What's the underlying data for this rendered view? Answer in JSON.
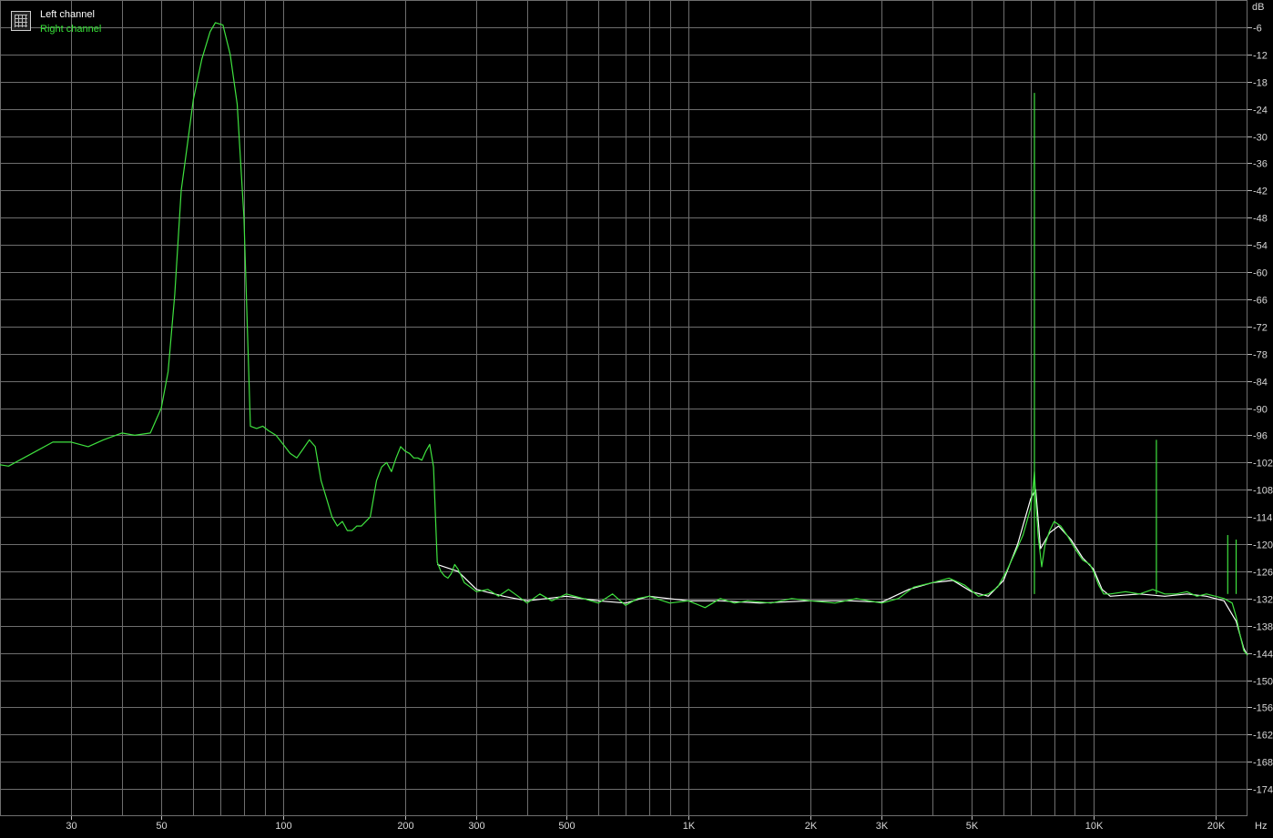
{
  "legend": {
    "icon": "spectrum-grid-icon",
    "left_label": "Left channel",
    "right_label": "Right channel",
    "left_color": "#ffffff",
    "right_color": "#3fe23f"
  },
  "chart_data": {
    "type": "line",
    "title": "",
    "xlabel": "",
    "ylabel": "",
    "x_unit_label": "Hz",
    "y_unit_label": "dB",
    "x_scale": "log",
    "xlim": [
      20,
      24000
    ],
    "ylim": [
      -180,
      0
    ],
    "grid": true,
    "background": "#000000",
    "grid_color": "#6e6e6e",
    "x_ticks": [
      {
        "value": 30,
        "label": "30"
      },
      {
        "value": 50,
        "label": "50"
      },
      {
        "value": 100,
        "label": "100"
      },
      {
        "value": 200,
        "label": "200"
      },
      {
        "value": 300,
        "label": "300"
      },
      {
        "value": 500,
        "label": "500"
      },
      {
        "value": 1000,
        "label": "1K"
      },
      {
        "value": 2000,
        "label": "2K"
      },
      {
        "value": 3000,
        "label": "3K"
      },
      {
        "value": 5000,
        "label": "5K"
      },
      {
        "value": 10000,
        "label": "10K"
      },
      {
        "value": 20000,
        "label": "20K"
      }
    ],
    "x_grid": [
      20,
      30,
      40,
      50,
      60,
      70,
      80,
      90,
      100,
      200,
      300,
      400,
      500,
      600,
      700,
      800,
      900,
      1000,
      2000,
      3000,
      4000,
      5000,
      6000,
      7000,
      8000,
      9000,
      10000,
      20000
    ],
    "y_ticks": [
      "-6",
      "-12",
      "-18",
      "-24",
      "-30",
      "-36",
      "-42",
      "-48",
      "-54",
      "-60",
      "-66",
      "-72",
      "-78",
      "-84",
      "-90",
      "-96",
      "-102",
      "-108",
      "-114",
      "-120",
      "-126",
      "-132",
      "-138",
      "-144",
      "-150",
      "-156",
      "-162",
      "-168",
      "-174"
    ],
    "series": [
      {
        "name": "Right channel",
        "color": "#3fe23f",
        "points": [
          [
            20,
            -102.5
          ],
          [
            21,
            -102.8
          ],
          [
            24,
            -100
          ],
          [
            27,
            -97.5
          ],
          [
            30,
            -97.5
          ],
          [
            33,
            -98.5
          ],
          [
            36,
            -97
          ],
          [
            40,
            -95.5
          ],
          [
            43,
            -96
          ],
          [
            47,
            -95.5
          ],
          [
            50,
            -90
          ],
          [
            52,
            -82
          ],
          [
            54,
            -65
          ],
          [
            56,
            -42
          ],
          [
            58,
            -32
          ],
          [
            60,
            -22
          ],
          [
            63,
            -13
          ],
          [
            66,
            -7
          ],
          [
            68,
            -5
          ],
          [
            71,
            -5.5
          ],
          [
            74,
            -12
          ],
          [
            77,
            -23
          ],
          [
            80,
            -48
          ],
          [
            83,
            -94
          ],
          [
            86,
            -94.5
          ],
          [
            89,
            -94
          ],
          [
            92,
            -95
          ],
          [
            96,
            -96
          ],
          [
            100,
            -98
          ],
          [
            104,
            -100
          ],
          [
            108,
            -101
          ],
          [
            112,
            -99
          ],
          [
            116,
            -97
          ],
          [
            120,
            -98.5
          ],
          [
            124,
            -106
          ],
          [
            128,
            -110
          ],
          [
            132,
            -114
          ],
          [
            136,
            -116
          ],
          [
            140,
            -115
          ],
          [
            144,
            -117
          ],
          [
            148,
            -117
          ],
          [
            152,
            -116
          ],
          [
            156,
            -116
          ],
          [
            160,
            -115
          ],
          [
            164,
            -114
          ],
          [
            170,
            -106
          ],
          [
            175,
            -103
          ],
          [
            180,
            -102
          ],
          [
            185,
            -104
          ],
          [
            190,
            -101
          ],
          [
            195,
            -98.5
          ],
          [
            200,
            -99.5
          ],
          [
            205,
            -100
          ],
          [
            210,
            -101
          ],
          [
            215,
            -101
          ],
          [
            220,
            -101.5
          ],
          [
            225,
            -99.5
          ],
          [
            230,
            -98
          ],
          [
            235,
            -103
          ],
          [
            240,
            -124
          ],
          [
            245,
            -126
          ],
          [
            250,
            -127
          ],
          [
            255,
            -127.5
          ],
          [
            260,
            -126.5
          ],
          [
            265,
            -124.5
          ],
          [
            270,
            -125.5
          ],
          [
            275,
            -127
          ],
          [
            280,
            -128.5
          ],
          [
            290,
            -129.5
          ],
          [
            300,
            -130.5
          ],
          [
            320,
            -130
          ],
          [
            340,
            -131.5
          ],
          [
            360,
            -130
          ],
          [
            380,
            -131.5
          ],
          [
            400,
            -133
          ],
          [
            430,
            -131
          ],
          [
            460,
            -132.5
          ],
          [
            500,
            -131
          ],
          [
            550,
            -132
          ],
          [
            600,
            -133
          ],
          [
            650,
            -131
          ],
          [
            700,
            -133.5
          ],
          [
            750,
            -132
          ],
          [
            800,
            -131.5
          ],
          [
            900,
            -133
          ],
          [
            1000,
            -132.5
          ],
          [
            1100,
            -134
          ],
          [
            1200,
            -132
          ],
          [
            1300,
            -133
          ],
          [
            1400,
            -132.5
          ],
          [
            1600,
            -133
          ],
          [
            1800,
            -132
          ],
          [
            2000,
            -132.5
          ],
          [
            2300,
            -133
          ],
          [
            2600,
            -132
          ],
          [
            3000,
            -133
          ],
          [
            3300,
            -132
          ],
          [
            3600,
            -129.5
          ],
          [
            4000,
            -128.5
          ],
          [
            4400,
            -127.5
          ],
          [
            4800,
            -129
          ],
          [
            5200,
            -131.5
          ],
          [
            5500,
            -131
          ],
          [
            5800,
            -129.5
          ],
          [
            6100,
            -126
          ],
          [
            6400,
            -122
          ],
          [
            6700,
            -118
          ],
          [
            6900,
            -114
          ],
          [
            7000,
            -112
          ],
          [
            7100,
            -107
          ],
          [
            7150,
            -104
          ],
          [
            7200,
            -110
          ],
          [
            7300,
            -118
          ],
          [
            7450,
            -125
          ],
          [
            7600,
            -120
          ],
          [
            7800,
            -117
          ],
          [
            8000,
            -115
          ],
          [
            8300,
            -116
          ],
          [
            8600,
            -118
          ],
          [
            9000,
            -121
          ],
          [
            9400,
            -123.5
          ],
          [
            9800,
            -124.5
          ],
          [
            10000,
            -126
          ],
          [
            10300,
            -129
          ],
          [
            10600,
            -131
          ],
          [
            11000,
            -131
          ],
          [
            12000,
            -130.5
          ],
          [
            13000,
            -131
          ],
          [
            14000,
            -130
          ],
          [
            15000,
            -131
          ],
          [
            16000,
            -131
          ],
          [
            17000,
            -130.5
          ],
          [
            18000,
            -131.5
          ],
          [
            19000,
            -131
          ],
          [
            20000,
            -131.5
          ],
          [
            21000,
            -132
          ],
          [
            22000,
            -133
          ],
          [
            22500,
            -136
          ],
          [
            23000,
            -140
          ],
          [
            23500,
            -143.5
          ],
          [
            24000,
            -144.5
          ]
        ]
      },
      {
        "name": "Left channel",
        "color": "#ffffff",
        "points": [
          [
            240,
            -124.5
          ],
          [
            270,
            -126
          ],
          [
            300,
            -130
          ],
          [
            350,
            -131.5
          ],
          [
            400,
            -132.5
          ],
          [
            500,
            -131.5
          ],
          [
            600,
            -132.5
          ],
          [
            700,
            -133
          ],
          [
            800,
            -131.5
          ],
          [
            1000,
            -132.5
          ],
          [
            1200,
            -132.5
          ],
          [
            1500,
            -133
          ],
          [
            2000,
            -132.5
          ],
          [
            2500,
            -132.5
          ],
          [
            3000,
            -132.8
          ],
          [
            3500,
            -130
          ],
          [
            4000,
            -128.5
          ],
          [
            4500,
            -128
          ],
          [
            5000,
            -130.5
          ],
          [
            5500,
            -131.5
          ],
          [
            6000,
            -128
          ],
          [
            6500,
            -120
          ],
          [
            7000,
            -110
          ],
          [
            7200,
            -108
          ],
          [
            7400,
            -121
          ],
          [
            7800,
            -117.5
          ],
          [
            8200,
            -116
          ],
          [
            8800,
            -119
          ],
          [
            9400,
            -123
          ],
          [
            10000,
            -125.5
          ],
          [
            10500,
            -130
          ],
          [
            11000,
            -131.5
          ],
          [
            13000,
            -131
          ],
          [
            15000,
            -131.5
          ],
          [
            17000,
            -131
          ],
          [
            19000,
            -131.5
          ],
          [
            21000,
            -132.5
          ],
          [
            22500,
            -137
          ],
          [
            23500,
            -143
          ],
          [
            24000,
            -144.5
          ]
        ]
      }
    ],
    "spikes": [
      {
        "freq": 7150,
        "level": -20.5
      },
      {
        "freq": 14300,
        "level": -97
      },
      {
        "freq": 21450,
        "level": -118
      },
      {
        "freq": 22500,
        "level": -119
      }
    ]
  }
}
